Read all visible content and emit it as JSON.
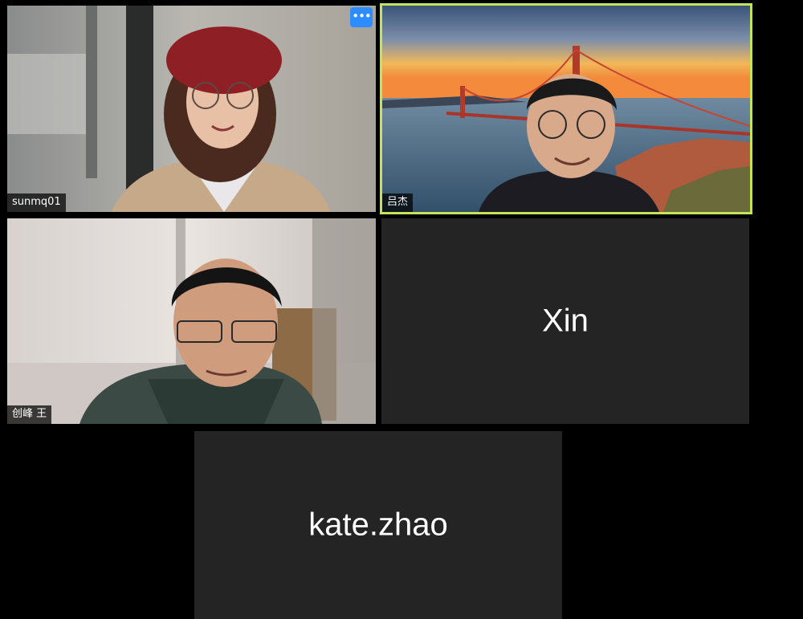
{
  "colors": {
    "background": "#000000",
    "tile_background": "#242424",
    "active_speaker_border": "#c3e35b",
    "more_button": "#2d8cff"
  },
  "participants": [
    {
      "name": "sunmq01",
      "video": true,
      "more_button_icon": "more-options-icon",
      "more_button_glyph": "•••"
    },
    {
      "name": "吕杰",
      "video": true,
      "active_speaker": true,
      "background": "golden-gate-bridge-sunset"
    },
    {
      "name": "创峰 王",
      "video": true
    },
    {
      "name": "Xin",
      "video": false
    },
    {
      "name": "kate.zhao",
      "video": false
    }
  ]
}
